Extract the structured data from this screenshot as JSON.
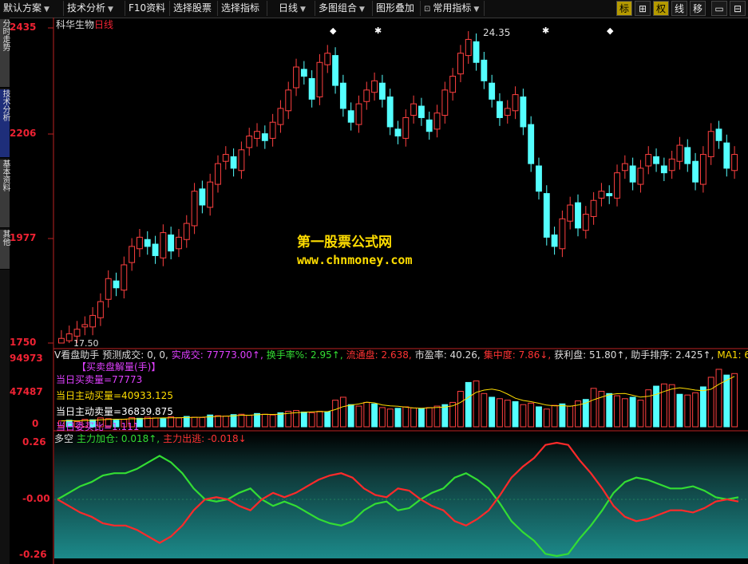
{
  "toolbar": {
    "buttons": [
      {
        "label": "默认方案"
      },
      {
        "label": "技术分析"
      },
      {
        "label": "F10资料"
      },
      {
        "label": "选择股票"
      },
      {
        "label": "选择指标"
      },
      {
        "label": "日线"
      },
      {
        "label": "多图组合"
      },
      {
        "label": "图形叠加"
      },
      {
        "label": "常用指标"
      }
    ],
    "right_buttons": [
      "标",
      "⊞",
      "权",
      "线",
      "移"
    ]
  },
  "side_tabs": [
    "分时走势",
    "技术分析",
    "基本资料",
    "其他"
  ],
  "chart_title": {
    "stock": "科华生物",
    "period": "日线"
  },
  "price_axis": [
    "2435",
    "2206",
    "1977",
    "1750"
  ],
  "price_annotations": {
    "high": "24.35",
    "low": "17.50"
  },
  "watermark": {
    "line1": "第一股票公式网",
    "line2": "www.chnmoney.com"
  },
  "volume_panel": {
    "header": [
      {
        "text": "V看盘助手",
        "color": "#dddddd"
      },
      {
        "text": "预测成交: 0, 0,",
        "color": "#dddddd"
      },
      {
        "text": "实成交: 77773.00↑,",
        "color": "#e040ff"
      },
      {
        "text": "换手率%: 2.95↑,",
        "color": "#33dd33"
      },
      {
        "text": "流通盘: 2.638,",
        "color": "#ff3333"
      },
      {
        "text": "市盈率: 40.26,",
        "color": "#dddddd"
      },
      {
        "text": "集中度: 7.86↓,",
        "color": "#ff3333"
      },
      {
        "text": "获利盘: 51.80↑,",
        "color": "#dddddd"
      },
      {
        "text": "助手排序: 2.425↑,",
        "color": "#dddddd"
      },
      {
        "text": "MA1: 6",
        "color": "#ffdd00"
      }
    ],
    "subtitle": "【买卖盘解量(手)】",
    "lines": [
      {
        "text": "当日买卖量=77773",
        "color": "#e040ff"
      },
      {
        "text": "当日主动买量=40933.125",
        "color": "#ffdd00"
      },
      {
        "text": "当日主动卖量=36839.875",
        "color": "#ffffff"
      },
      {
        "text": "当日委买比=1.111",
        "color": "#e040ff"
      }
    ],
    "axis": [
      "94973",
      "47487",
      "0"
    ]
  },
  "oscillator_panel": {
    "header": [
      {
        "text": "多空",
        "color": "#dddddd"
      },
      {
        "text": "主力加仓: 0.018↑,",
        "color": "#33dd33"
      },
      {
        "text": "主力出逃: -0.018↓",
        "color": "#ff3333"
      }
    ],
    "axis": [
      "0.26",
      "-0.00",
      "-0.26"
    ]
  },
  "chart_data": [
    {
      "type": "candlestick",
      "title": "科华生物 日线",
      "ylim": [
        17.5,
        24.35
      ],
      "series": [
        {
          "name": "price",
          "values": [
            17.6,
            17.7,
            17.8,
            17.9,
            18.1,
            18.4,
            18.9,
            18.7,
            19.2,
            19.6,
            19.8,
            19.6,
            19.4,
            19.9,
            19.5,
            19.8,
            20.1,
            20.8,
            20.5,
            21.0,
            21.4,
            21.6,
            21.3,
            21.7,
            22.0,
            22.1,
            21.9,
            22.3,
            22.6,
            23.0,
            23.5,
            23.3,
            22.8,
            23.6,
            23.8,
            23.1,
            22.6,
            22.3,
            22.7,
            23.0,
            23.2,
            22.8,
            22.2,
            22.0,
            22.4,
            22.7,
            22.4,
            22.1,
            22.5,
            23.0,
            23.3,
            23.8,
            24.1,
            23.6,
            23.2,
            22.8,
            22.4,
            22.6,
            22.9,
            22.2,
            21.4,
            20.8,
            19.8,
            19.6,
            20.2,
            20.5,
            20.0,
            20.3,
            20.6,
            20.8,
            20.7,
            21.2,
            21.4,
            21.0,
            21.3,
            21.6,
            21.4,
            21.2,
            21.5,
            21.8,
            21.4,
            21.0,
            21.6,
            22.1,
            21.9,
            21.3,
            21.6
          ]
        }
      ]
    },
    {
      "type": "bar",
      "title": "V看盘助手",
      "ylim": [
        0,
        94973
      ],
      "series": [
        {
          "name": "volume",
          "values": [
            8000,
            9000,
            7000,
            10000,
            9500,
            12000,
            11000,
            9000,
            10000,
            12500,
            11500,
            13000,
            12000,
            11000,
            13500,
            12000,
            14000,
            13000,
            12500,
            16000,
            15000,
            14500,
            16500,
            17000,
            15500,
            18000,
            17000,
            16000,
            19000,
            21000,
            22000,
            20000,
            19000,
            21000,
            20500,
            36000,
            40000,
            30000,
            28000,
            33000,
            31000,
            26000,
            24000,
            25000,
            27000,
            25500,
            24500,
            26000,
            28000,
            30000,
            33000,
            48000,
            60000,
            62000,
            45000,
            40000,
            38000,
            36000,
            34000,
            30000,
            32000,
            27000,
            24000,
            29000,
            31000,
            28000,
            35000,
            37000,
            52000,
            48000,
            45000,
            42000,
            38000,
            40000,
            36000,
            50000,
            55000,
            58000,
            57000,
            44000,
            43000,
            46000,
            54000,
            67000,
            77773,
            70000,
            72000
          ]
        }
      ]
    },
    {
      "type": "line",
      "title": "多空",
      "ylim": [
        -0.26,
        0.26
      ],
      "series": [
        {
          "name": "主力加仓",
          "values": [
            0.0,
            0.03,
            0.06,
            0.08,
            0.11,
            0.12,
            0.12,
            0.14,
            0.17,
            0.2,
            0.17,
            0.12,
            0.05,
            0.0,
            -0.01,
            0.0,
            0.03,
            0.05,
            0.0,
            -0.03,
            -0.01,
            -0.03,
            -0.06,
            -0.09,
            -0.11,
            -0.12,
            -0.1,
            -0.05,
            -0.02,
            -0.01,
            -0.05,
            -0.04,
            0.0,
            0.03,
            0.05,
            0.1,
            0.12,
            0.09,
            0.05,
            -0.02,
            -0.1,
            -0.15,
            -0.19,
            -0.25,
            -0.28,
            -0.25,
            -0.18,
            -0.12,
            -0.05,
            0.03,
            0.08,
            0.1,
            0.09,
            0.07,
            0.05,
            0.05,
            0.06,
            0.04,
            0.01,
            0.0,
            0.01
          ]
        },
        {
          "name": "主力出逃",
          "values": [
            0.0,
            -0.03,
            -0.06,
            -0.08,
            -0.11,
            -0.12,
            -0.12,
            -0.14,
            -0.17,
            -0.2,
            -0.17,
            -0.12,
            -0.05,
            0.0,
            0.01,
            0.0,
            -0.03,
            -0.05,
            0.0,
            0.03,
            0.01,
            0.03,
            0.06,
            0.09,
            0.11,
            0.12,
            0.1,
            0.05,
            0.02,
            0.01,
            0.05,
            0.04,
            0.0,
            -0.03,
            -0.05,
            -0.1,
            -0.12,
            -0.09,
            -0.05,
            0.02,
            0.1,
            0.15,
            0.19,
            0.25,
            0.28,
            0.25,
            0.18,
            0.12,
            0.05,
            -0.03,
            -0.08,
            -0.1,
            -0.09,
            -0.07,
            -0.05,
            -0.05,
            -0.06,
            -0.04,
            -0.01,
            0.0,
            -0.01
          ]
        }
      ]
    }
  ]
}
